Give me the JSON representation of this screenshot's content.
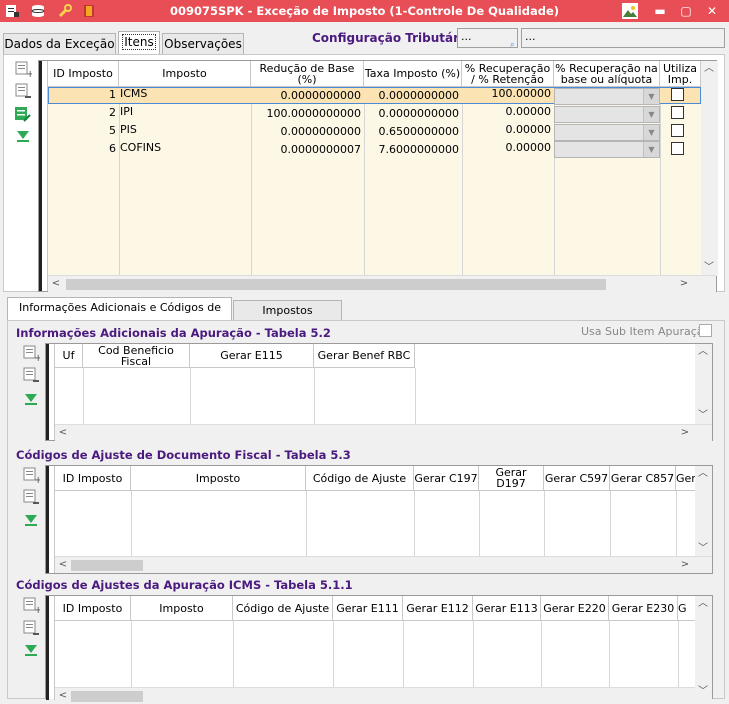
{
  "window": {
    "title": "009075SPK - Exceção de Imposto (1-Controle De Qualidade)"
  },
  "tabs": [
    {
      "label": "Dados da Exceção"
    },
    {
      "label": "Itens"
    },
    {
      "label": "Observações"
    }
  ],
  "config": {
    "label": "Configuração Tributária",
    "field1": "...",
    "field2": "..."
  },
  "items_grid": {
    "columns": [
      "ID Imposto",
      "Imposto",
      "Redução de Base (%)",
      "Taxa Imposto (%)",
      "% Recuperação / % Retenção",
      "% Recuperação na base ou alíquota",
      "Utiliza Imp."
    ],
    "rows": [
      {
        "id": "1",
        "imposto": "ICMS",
        "reducao": "0.0000000000",
        "taxa": "0.0000000000",
        "recuperacao": "100.00000",
        "base_aliquota": "",
        "utiliza": false
      },
      {
        "id": "2",
        "imposto": "IPI",
        "reducao": "100.0000000000",
        "taxa": "0.0000000000",
        "recuperacao": "0.00000",
        "base_aliquota": "",
        "utiliza": false
      },
      {
        "id": "5",
        "imposto": "PIS",
        "reducao": "0.0000000000",
        "taxa": "0.6500000000",
        "recuperacao": "0.00000",
        "base_aliquota": "",
        "utiliza": false
      },
      {
        "id": "6",
        "imposto": "COFINS",
        "reducao": "0.0000000007",
        "taxa": "7.6000000000",
        "recuperacao": "0.00000",
        "base_aliquota": "",
        "utiliza": false
      }
    ]
  },
  "lower_tabs": [
    {
      "label": "Informações Adicionais e Códigos de Ajuste"
    },
    {
      "label": "Impostos Vinculados"
    }
  ],
  "section_52": {
    "title": "Informações Adicionais da Apuração - Tabela 5.2",
    "checkbox_label": "Usa Sub Item Apuração",
    "columns": [
      "Uf",
      "Cod Beneficio Fiscal",
      "Gerar E115",
      "Gerar Benef RBC"
    ]
  },
  "section_53": {
    "title": "Códigos de Ajuste de Documento Fiscal - Tabela 5.3",
    "columns": [
      "ID Imposto",
      "Imposto",
      "Código de Ajuste",
      "Gerar C197",
      "Gerar D197",
      "Gerar C597",
      "Gerar C857",
      "Ger"
    ]
  },
  "section_511": {
    "title": "Códigos de Ajustes da Apuração ICMS - Tabela 5.1.1",
    "columns": [
      "ID Imposto",
      "Imposto",
      "Código de Ajuste",
      "Gerar E111",
      "Gerar E112",
      "Gerar E113",
      "Gerar E220",
      "Gerar E230",
      "G"
    ]
  },
  "colors": {
    "titlebar": "#e84e55",
    "section_title": "#4b1a7e",
    "row_cream": "#fdf7e6",
    "row_selected": "#fbe3b4"
  }
}
